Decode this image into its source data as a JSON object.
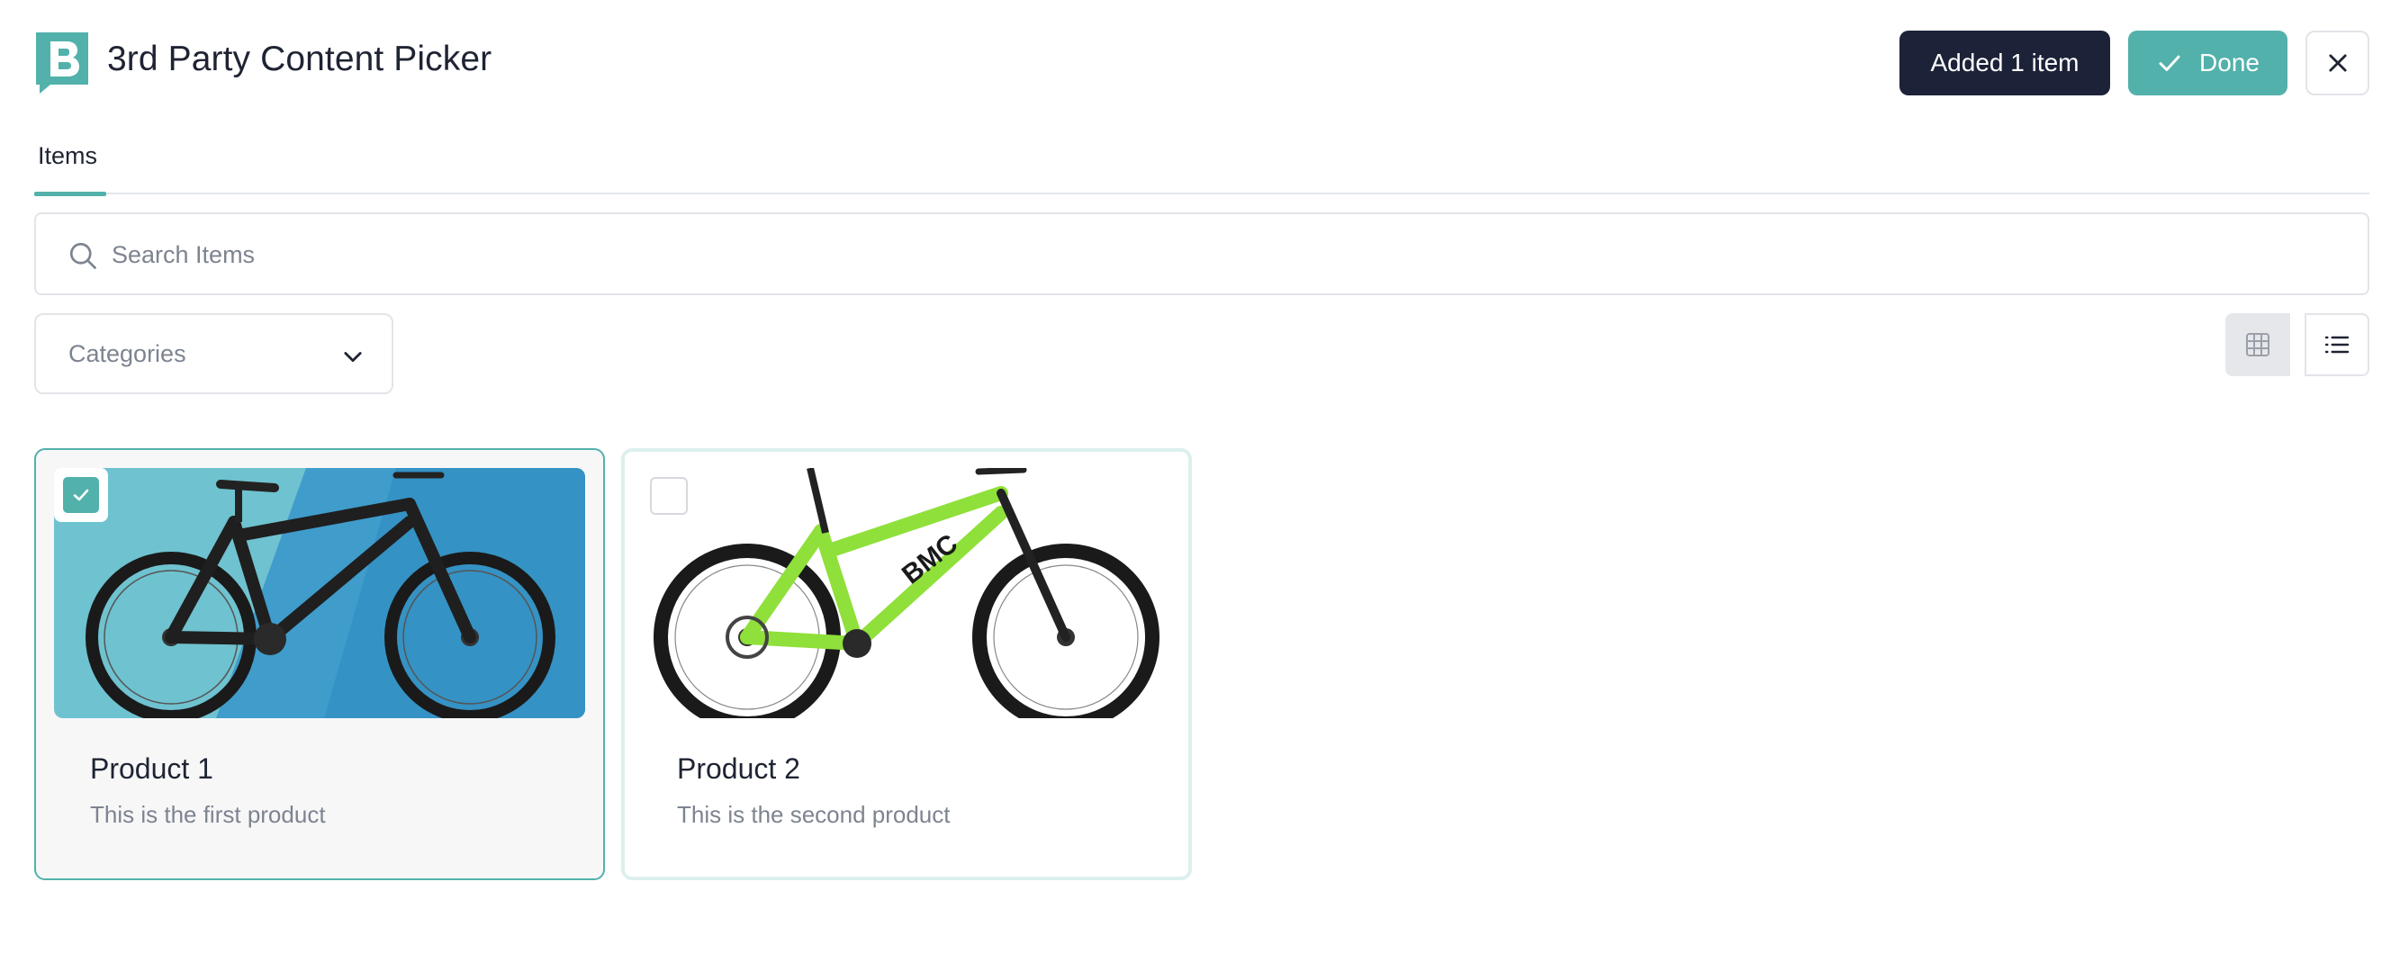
{
  "header": {
    "title": "3rd Party Content Picker",
    "logo_icon": "brand-b-logo-icon",
    "added_label": "Added 1 item",
    "done_label": "Done",
    "accent_color": "#52b1ab",
    "dark_color": "#1c2237"
  },
  "tabs": [
    {
      "label": "Items",
      "active": true
    }
  ],
  "search": {
    "value": "",
    "placeholder": "Search Items"
  },
  "filters": {
    "categories_label": "Categories"
  },
  "view": {
    "modes": [
      "grid",
      "list"
    ],
    "active": "grid"
  },
  "products": [
    {
      "title": "Product 1",
      "description": "This is the first product",
      "selected": true,
      "image": "black full-suspension mountain bike on teal background"
    },
    {
      "title": "Product 2",
      "description": "This is the second product",
      "selected": false,
      "image": "lime green BMC hardtail mountain bike on white background"
    }
  ]
}
